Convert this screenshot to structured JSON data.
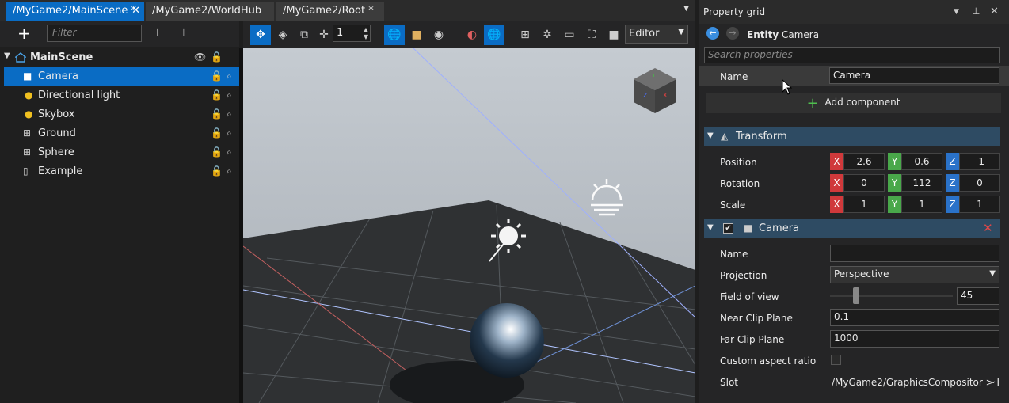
{
  "tabs": [
    {
      "label": "/MyGame2/MainScene *",
      "close": "✕"
    },
    {
      "label": "/MyGame2/WorldHub"
    },
    {
      "label": "/MyGame2/Root *"
    }
  ],
  "left": {
    "filter_placeholder": "Filter",
    "root": "MainScene",
    "items": [
      {
        "label": "Camera",
        "icon": "camera-icon"
      },
      {
        "label": "Directional light",
        "icon": "light-icon"
      },
      {
        "label": "Skybox",
        "icon": "light-icon"
      },
      {
        "label": "Ground",
        "icon": "entity-icon"
      },
      {
        "label": "Sphere",
        "icon": "entity-icon"
      },
      {
        "label": "Example",
        "icon": "script-icon"
      }
    ]
  },
  "toolbar": {
    "snap_value": "1",
    "mode": "Editor"
  },
  "property_grid": {
    "title": "Property grid",
    "entity_prefix": "Entity",
    "entity_name": "Camera",
    "search_placeholder": "Search properties",
    "name_label": "Name",
    "name_value": "Camera",
    "add_component": "Add component",
    "transform": {
      "title": "Transform",
      "position": {
        "label": "Position",
        "x": "2.6",
        "y": "0.6",
        "z": "-1"
      },
      "rotation": {
        "label": "Rotation",
        "x": "0",
        "y": "112",
        "z": "0"
      },
      "scale": {
        "label": "Scale",
        "x": "1",
        "y": "1",
        "z": "1"
      }
    },
    "camera": {
      "title": "Camera",
      "name_label": "Name",
      "name_value": "",
      "projection_label": "Projection",
      "projection_value": "Perspective",
      "fov_label": "Field of view",
      "fov_value": "45",
      "fov_fraction": 0.2,
      "near_label": "Near Clip Plane",
      "near_value": "0.1",
      "far_label": "Far Clip Plane",
      "far_value": "1000",
      "aspect_label": "Custom aspect ratio",
      "slot_label": "Slot",
      "slot_value": "/MyGame2/GraphicsCompositor > I"
    }
  },
  "colors": {
    "accent": "#0a6cc4",
    "axis_x": "#d0393b",
    "axis_y": "#49a84a",
    "axis_z": "#2a72c9",
    "section": "#2e4b63"
  }
}
